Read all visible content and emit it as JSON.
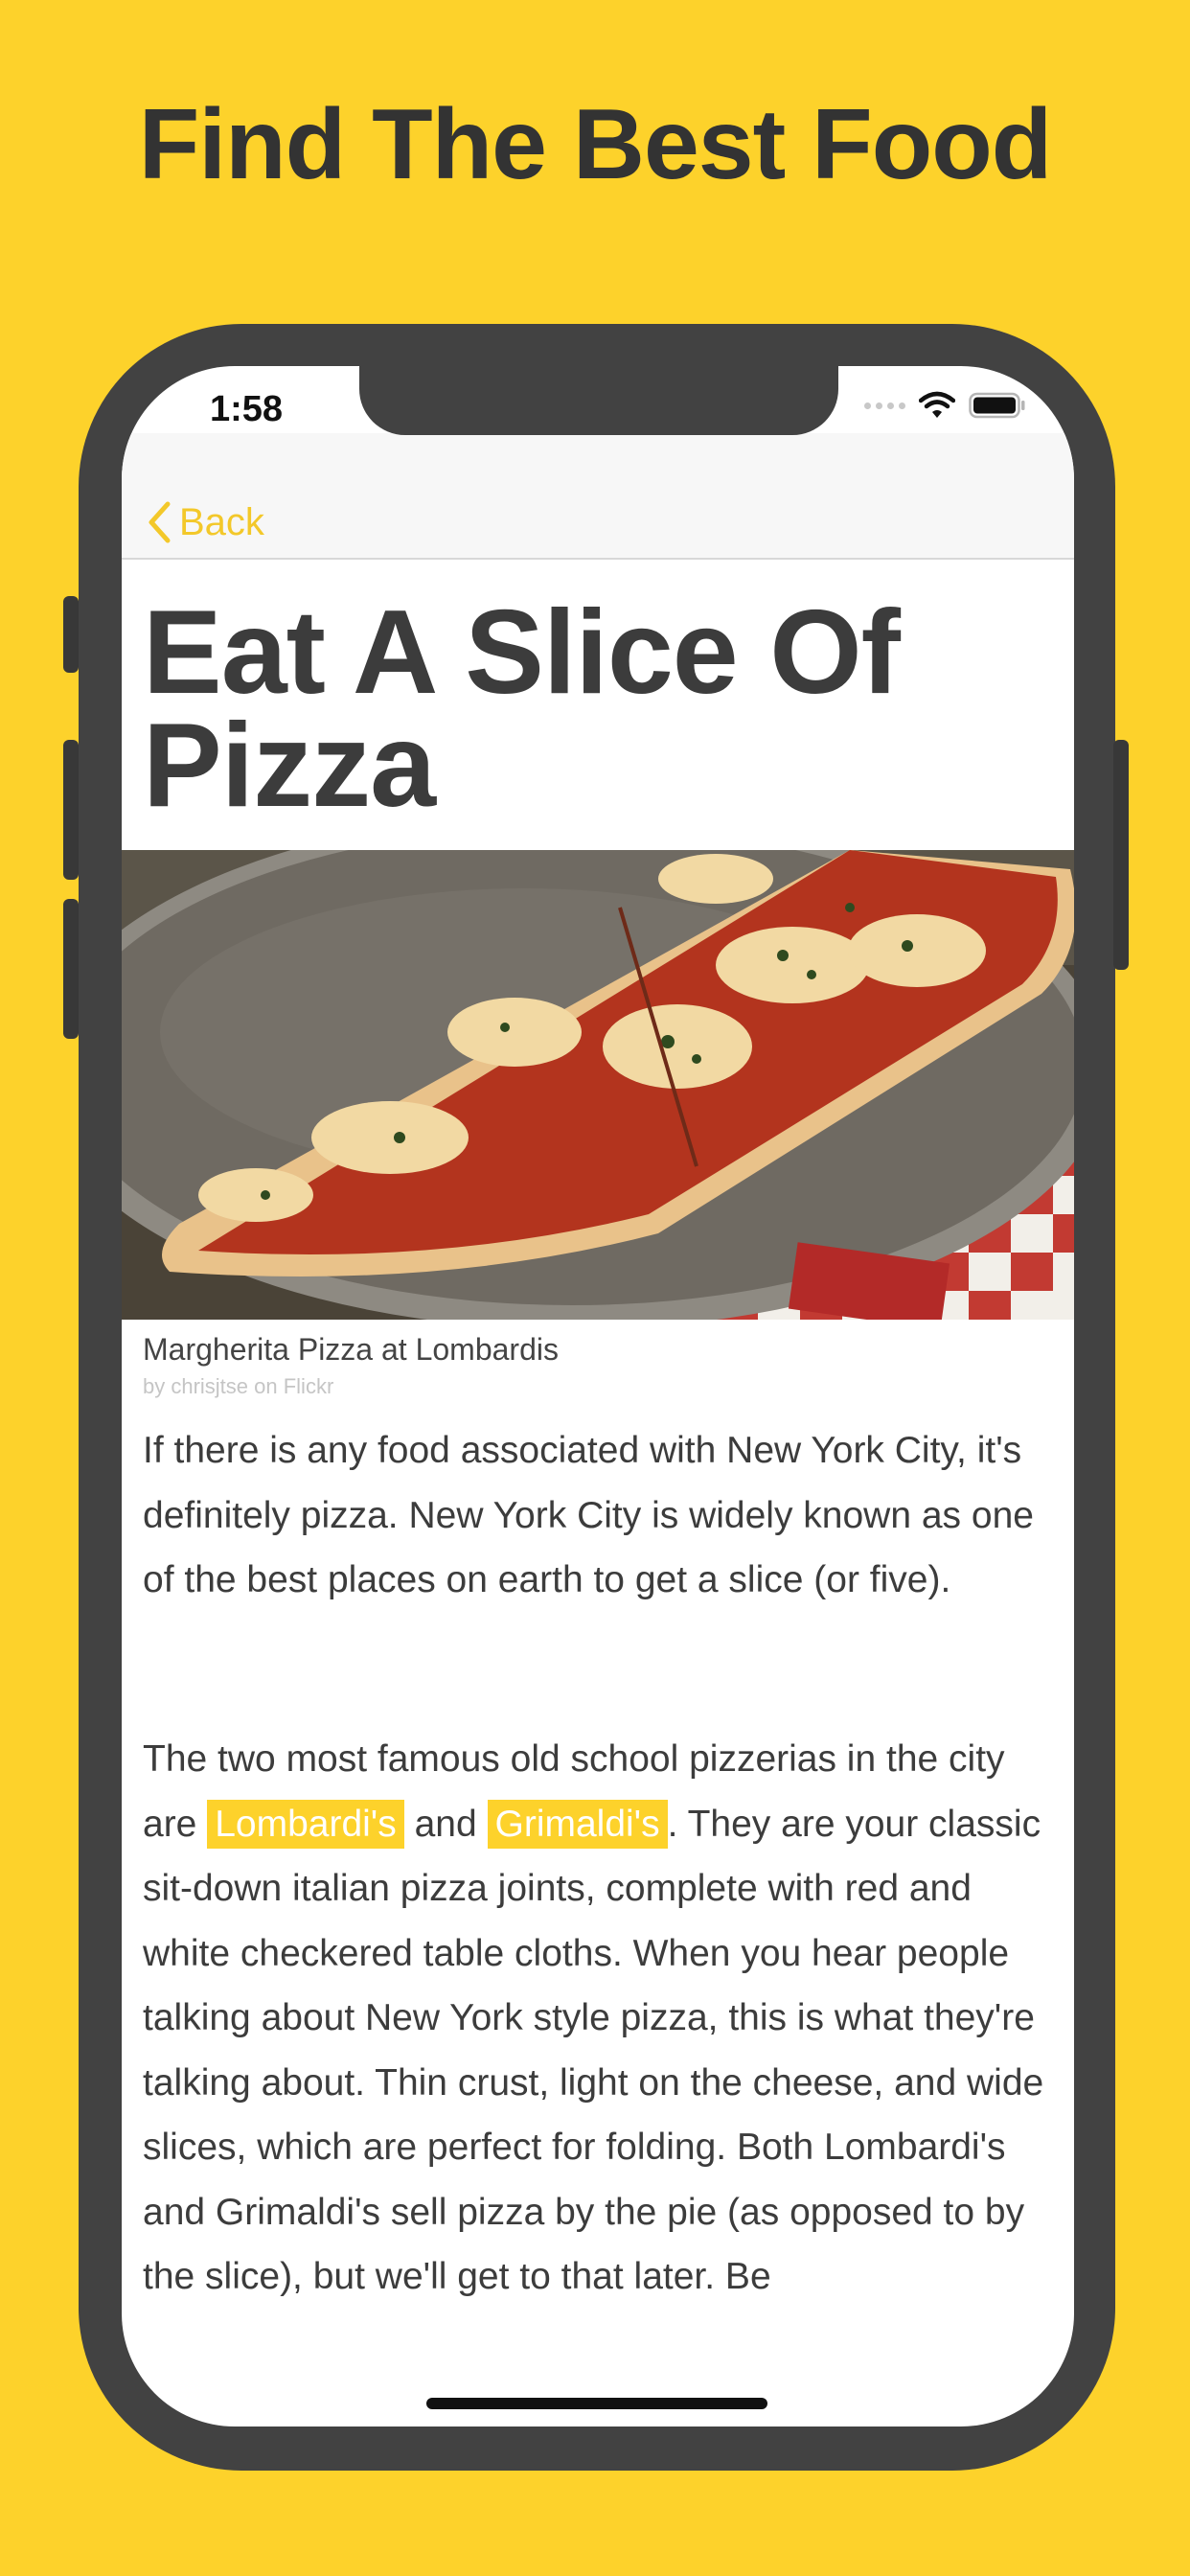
{
  "promo": {
    "headline": "Find The Best Food"
  },
  "status_bar": {
    "time": "1:58"
  },
  "nav": {
    "back_label": "Back"
  },
  "article": {
    "title": "Eat A Slice Of Pizza",
    "image": {
      "caption": "Margherita Pizza at Lombardis",
      "credit": "by chrisjtse on Flickr"
    },
    "paragraph1": "If there is any food associated with New York City, it's definitely pizza. New York City is widely known as one of the best places on earth to get a slice (or five).",
    "paragraph2": {
      "lead": "The two most famous old school pizzerias in the city are ",
      "link1": "Lombardi's",
      "between": " and ",
      "link2": "Grimaldi's",
      "rest": ". They are your classic sit-down italian pizza joints, complete with red and white checkered table cloths. When you hear people talking about New York style pizza, this is what they're talking about. Thin crust, light on the cheese, and wide slices, which are perfect for folding. Both Lombardi's and Grimaldi's sell pizza by the pie (as opposed to by the slice), but we'll get to that later. Be"
    }
  },
  "colors": {
    "accent": "#FDD22B",
    "back_tint": "#F3C82A",
    "frame": "#424242"
  },
  "icons": [
    "chevron-left-icon",
    "wifi-icon",
    "battery-icon",
    "signal-icon"
  ]
}
